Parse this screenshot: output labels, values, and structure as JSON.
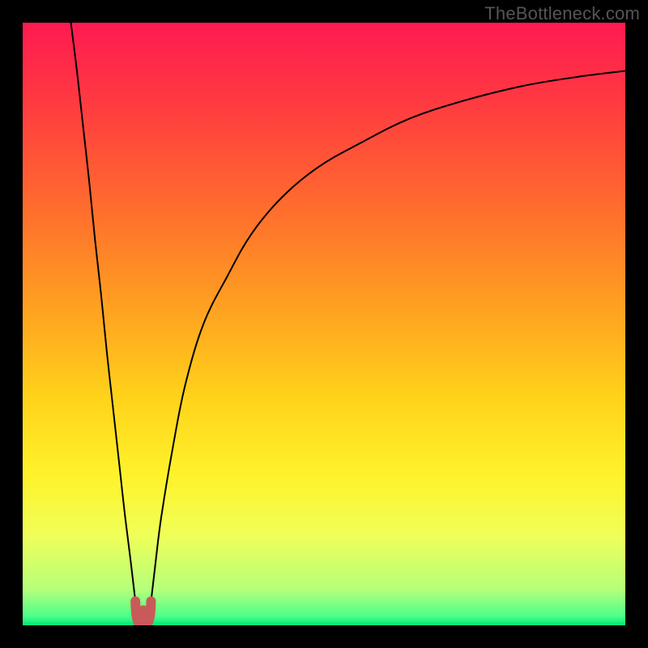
{
  "watermark": "TheBottleneck.com",
  "chart_data": {
    "type": "line",
    "title": "",
    "xlabel": "",
    "ylabel": "",
    "xlim": [
      0,
      100
    ],
    "ylim": [
      0,
      100
    ],
    "grid": false,
    "legend": false,
    "background_gradient": {
      "stops": [
        {
          "offset": 0.0,
          "color": "#ff1a52"
        },
        {
          "offset": 0.12,
          "color": "#ff3742"
        },
        {
          "offset": 0.3,
          "color": "#ff6a2e"
        },
        {
          "offset": 0.48,
          "color": "#ffa320"
        },
        {
          "offset": 0.62,
          "color": "#ffd21a"
        },
        {
          "offset": 0.75,
          "color": "#fff22a"
        },
        {
          "offset": 0.85,
          "color": "#f0ff58"
        },
        {
          "offset": 0.94,
          "color": "#b6ff7a"
        },
        {
          "offset": 0.985,
          "color": "#4dff8a"
        },
        {
          "offset": 1.0,
          "color": "#00e676"
        }
      ]
    },
    "series": [
      {
        "name": "left-branch",
        "color": "#000000",
        "width": 2,
        "x": [
          8.0,
          9.0,
          10.0,
          11.0,
          12.0,
          13.0,
          14.0,
          15.0,
          16.0,
          17.0,
          18.0,
          18.7
        ],
        "y": [
          100.0,
          92.0,
          83.0,
          74.0,
          64.0,
          55.0,
          45.0,
          36.0,
          27.0,
          18.0,
          10.0,
          4.0
        ]
      },
      {
        "name": "right-branch",
        "color": "#000000",
        "width": 2,
        "x": [
          21.3,
          22.0,
          23.0,
          25.0,
          27.0,
          30.0,
          34.0,
          38.0,
          43.0,
          49.0,
          56.0,
          64.0,
          73.0,
          83.0,
          92.0,
          100.0
        ],
        "y": [
          4.0,
          10.0,
          18.0,
          30.0,
          40.0,
          50.0,
          58.0,
          65.0,
          71.0,
          76.0,
          80.0,
          84.0,
          87.0,
          89.5,
          91.0,
          92.0
        ]
      }
    ],
    "notch": {
      "color": "#c95a5a",
      "x": [
        18.7,
        18.8,
        19.0,
        19.3,
        19.6,
        20.0,
        20.4,
        20.7,
        21.0,
        21.2,
        21.3
      ],
      "y": [
        4.0,
        2.2,
        1.0,
        0.4,
        0.9,
        2.5,
        0.9,
        0.4,
        1.0,
        2.2,
        4.0
      ]
    }
  }
}
